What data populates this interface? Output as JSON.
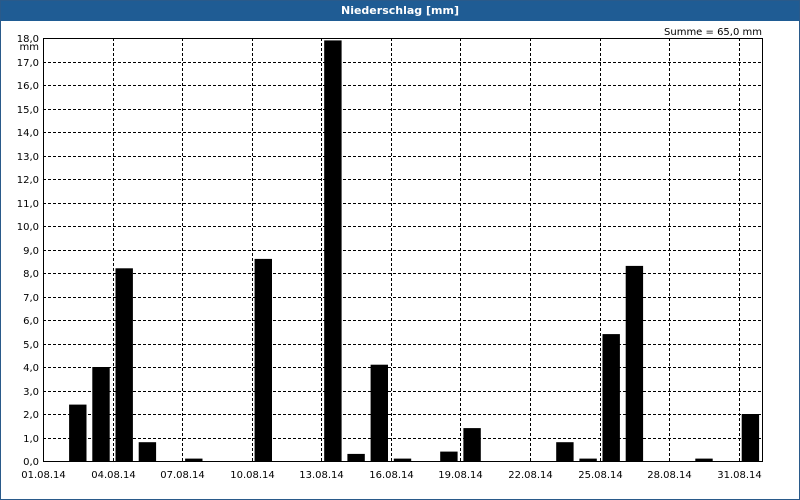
{
  "window": {
    "title": "Niederschlag [mm]"
  },
  "summary": {
    "label": "Summe = 65,0 mm"
  },
  "colors": {
    "title_bar": "#1f5c94",
    "bars": "#000000",
    "grid": "#000000"
  },
  "chart_data": {
    "type": "bar",
    "title": "Niederschlag [mm]",
    "ylabel": "mm",
    "xlabel": "",
    "ylim": [
      0,
      18
    ],
    "y_ticks": [
      "0,0",
      "1,0",
      "2,0",
      "3,0",
      "4,0",
      "5,0",
      "6,0",
      "7,0",
      "8,0",
      "9,0",
      "10,0",
      "11,0",
      "12,0",
      "13,0",
      "14,0",
      "15,0",
      "16,0",
      "17,0",
      "18,0"
    ],
    "x_tick_labels": [
      "01.08.14",
      "04.08.14",
      "07.08.14",
      "10.08.14",
      "13.08.14",
      "16.08.14",
      "19.08.14",
      "22.08.14",
      "25.08.14",
      "28.08.14",
      "31.08.14"
    ],
    "categories": [
      "01.08.14",
      "02.08.14",
      "03.08.14",
      "04.08.14",
      "05.08.14",
      "06.08.14",
      "07.08.14",
      "08.08.14",
      "09.08.14",
      "10.08.14",
      "11.08.14",
      "12.08.14",
      "13.08.14",
      "14.08.14",
      "15.08.14",
      "16.08.14",
      "17.08.14",
      "18.08.14",
      "19.08.14",
      "20.08.14",
      "21.08.14",
      "22.08.14",
      "23.08.14",
      "24.08.14",
      "25.08.14",
      "26.08.14",
      "27.08.14",
      "28.08.14",
      "29.08.14",
      "30.08.14",
      "31.08.14"
    ],
    "values": [
      0,
      2.4,
      4.0,
      8.2,
      0.8,
      0,
      0.1,
      0,
      0,
      8.6,
      0,
      0,
      17.9,
      0.3,
      4.1,
      0.1,
      0,
      0.4,
      1.4,
      0,
      0,
      0,
      0.8,
      0.1,
      5.4,
      8.3,
      0,
      0,
      0.1,
      0,
      2.0
    ],
    "grid": true,
    "legend": "none"
  }
}
